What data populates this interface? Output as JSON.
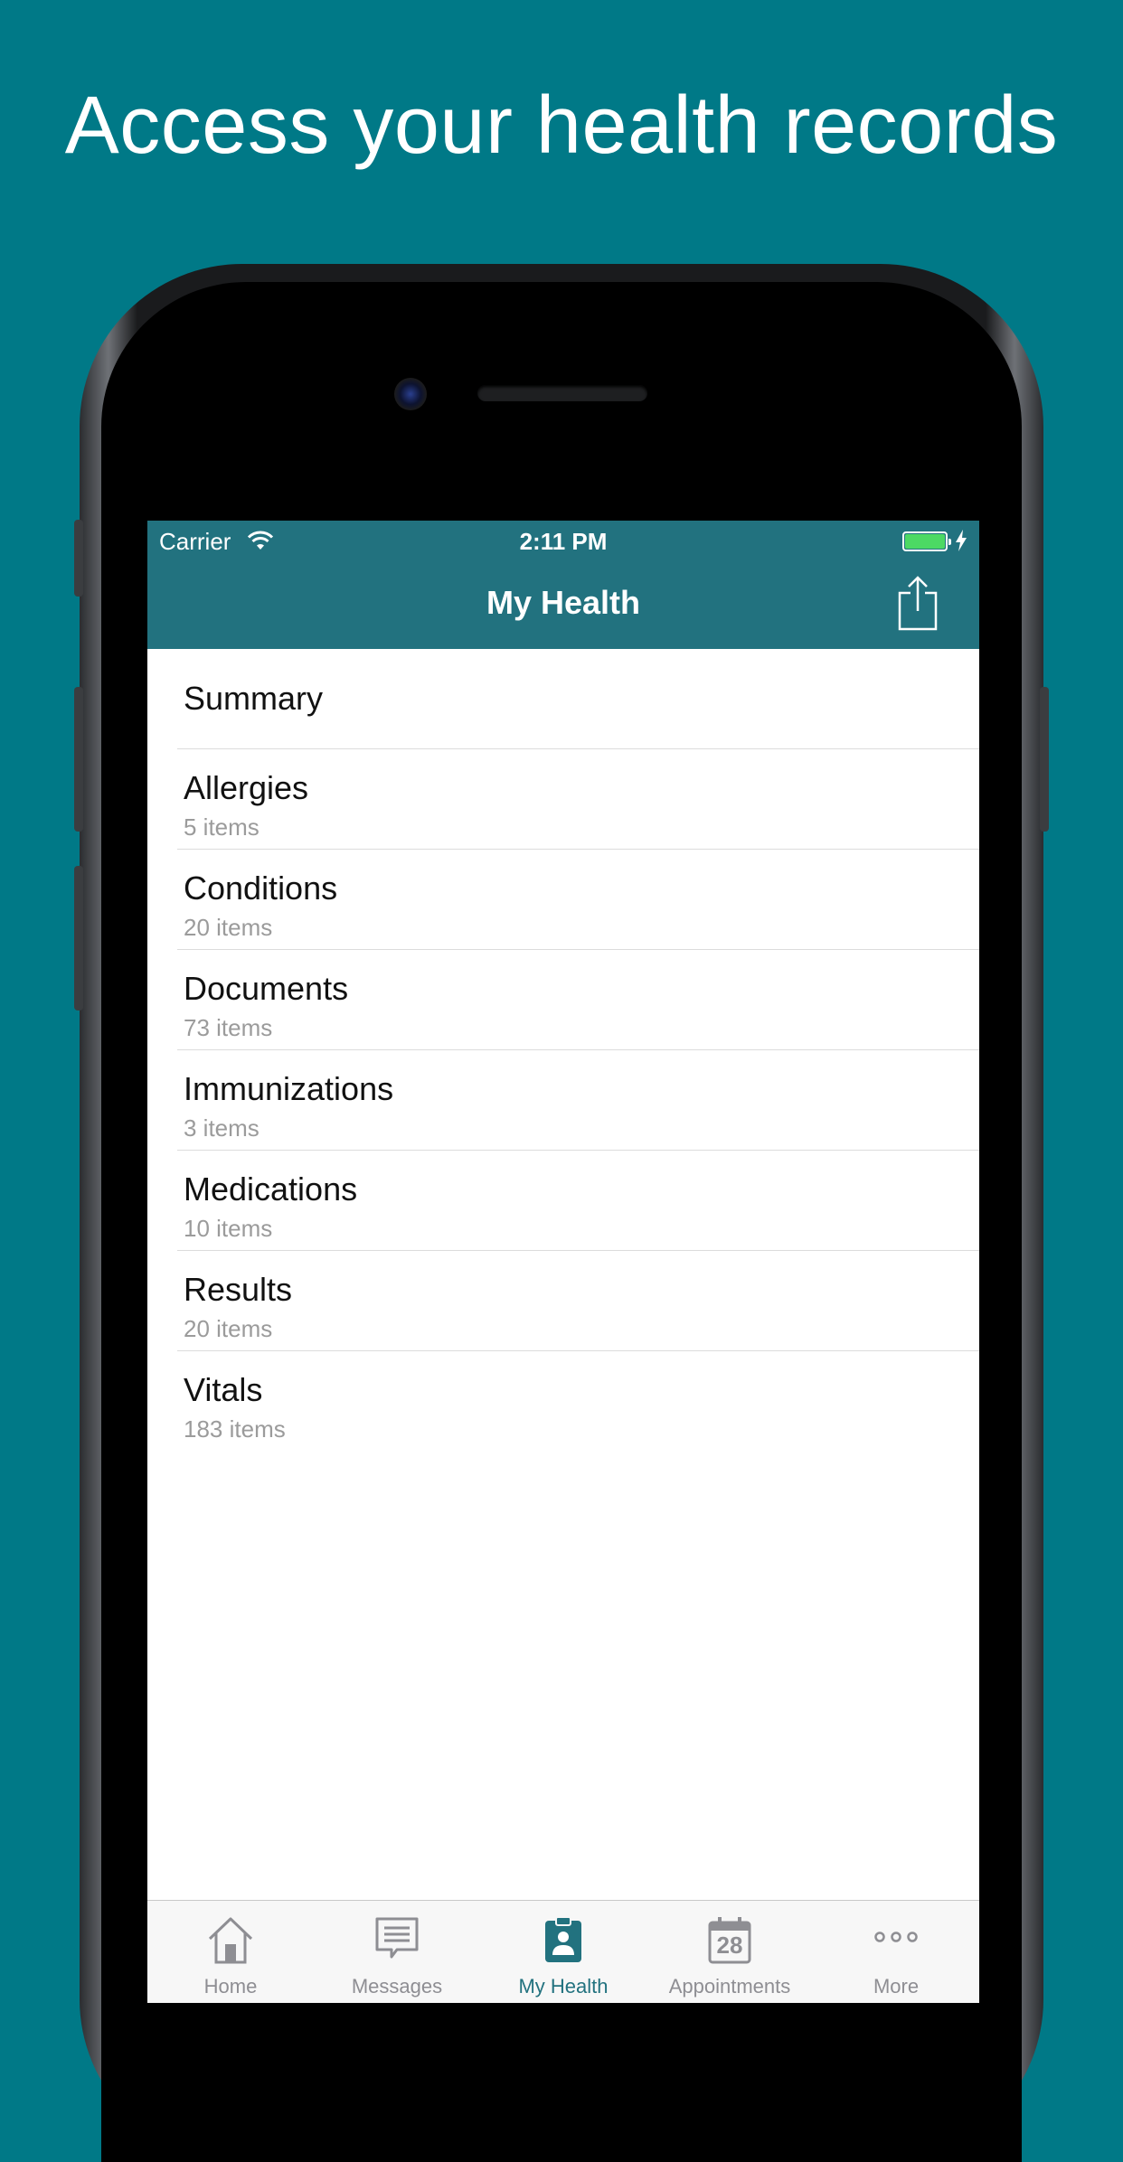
{
  "headline": "Access your health records",
  "status_bar": {
    "carrier": "Carrier",
    "time": "2:11 PM"
  },
  "nav": {
    "title": "My Health",
    "share_icon": "share-icon"
  },
  "list": [
    {
      "title": "Summary",
      "subtitle": ""
    },
    {
      "title": "Allergies",
      "subtitle": "5 items"
    },
    {
      "title": "Conditions",
      "subtitle": "20 items"
    },
    {
      "title": "Documents",
      "subtitle": "73 items"
    },
    {
      "title": "Immunizations",
      "subtitle": "3 items"
    },
    {
      "title": "Medications",
      "subtitle": "10 items"
    },
    {
      "title": "Results",
      "subtitle": "20 items"
    },
    {
      "title": "Vitals",
      "subtitle": "183 items"
    }
  ],
  "tabs": [
    {
      "label": "Home",
      "icon": "home-icon"
    },
    {
      "label": "Messages",
      "icon": "messages-icon"
    },
    {
      "label": "My Health",
      "icon": "clipboard-icon",
      "active": true
    },
    {
      "label": "Appointments",
      "icon": "calendar-icon",
      "day": "28"
    },
    {
      "label": "More",
      "icon": "more-icon"
    }
  ],
  "colors": {
    "background": "#007987",
    "nav_bar": "#22727f",
    "active_tab": "#22727f",
    "inactive_tab": "#8e8e93",
    "battery": "#4cd964"
  }
}
